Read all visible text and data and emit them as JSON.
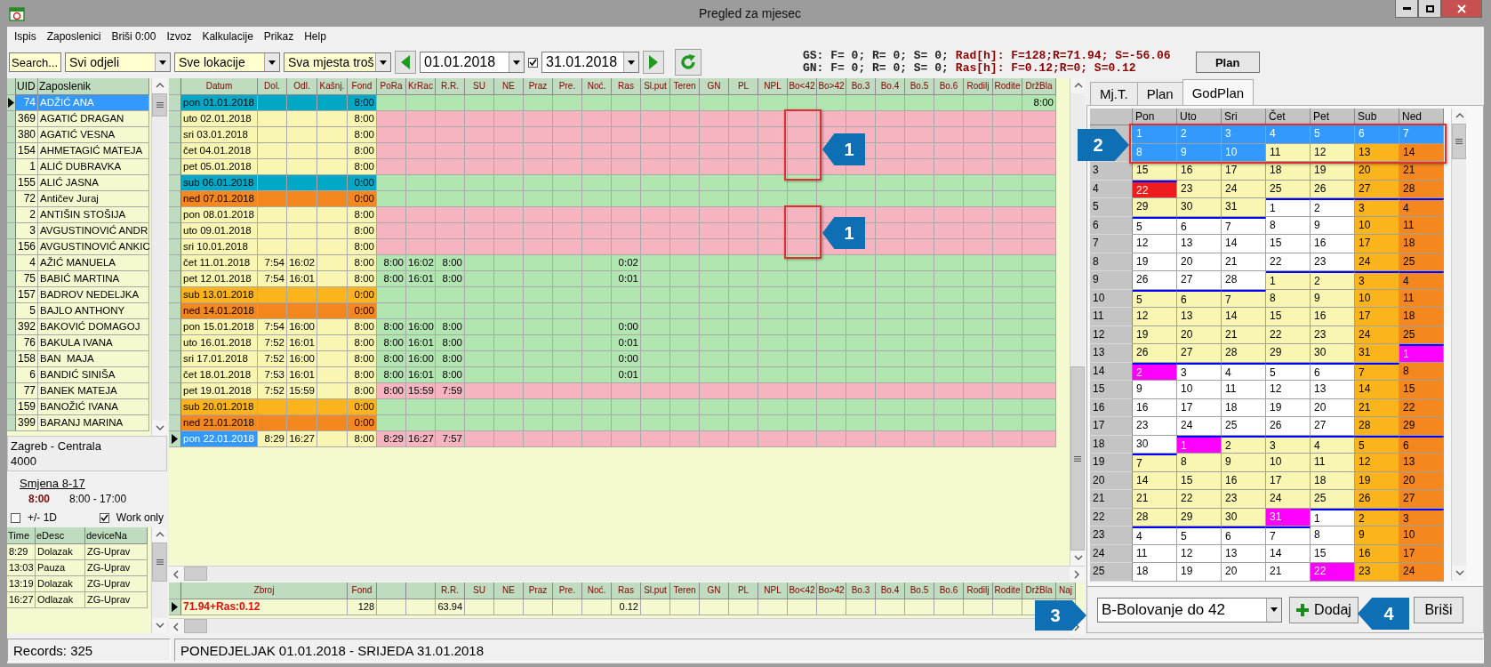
{
  "window": {
    "title": "Pregled za mjesec"
  },
  "menu": [
    "Ispis",
    "Zaposlenici",
    "Briši 0:00",
    "Izvoz",
    "Kalkulacije",
    "Prikaz",
    "Help"
  ],
  "toolbar": {
    "search": "Search...",
    "filters": [
      "Svi odjeli",
      "Sve lokacije",
      "Sva mjesta troš"
    ],
    "date_from": "01.01.2018",
    "date_to_enabled": true,
    "date_to": "31.01.2018"
  },
  "summary": [
    {
      "label": "GS: F= 0; R= 0; S= 0;",
      "value": "Rad[h]: F=128;R=71.94; S=-56.06"
    },
    {
      "label": "GN: F= 0; R= 0; S= 0;",
      "value": "Ras[h]: F=0.12;R=0; S=0.12"
    }
  ],
  "plan_button": "Plan",
  "employees": {
    "columns": [
      "UID",
      "Zaposlenik"
    ],
    "rows": [
      {
        "uid": "74",
        "name": "ADŽIĆ ANA",
        "selected": true
      },
      {
        "uid": "369",
        "name": "AGATIĆ DRAGAN",
        "selected": false
      },
      {
        "uid": "380",
        "name": "AGATIĆ VESNA",
        "selected": false
      },
      {
        "uid": "154",
        "name": "AHMETAGIĆ MATEJA",
        "selected": false
      },
      {
        "uid": "1",
        "name": "ALIĆ DUBRAVKA",
        "selected": false
      },
      {
        "uid": "155",
        "name": "ALIĆ JASNA",
        "selected": false
      },
      {
        "uid": "72",
        "name": "Antičev Juraj",
        "selected": false
      },
      {
        "uid": "2",
        "name": "ANTIŠIN STOŠIJA",
        "selected": false
      },
      {
        "uid": "3",
        "name": "AVGUSTINOVIĆ ANDR",
        "selected": false
      },
      {
        "uid": "156",
        "name": "AVGUSTINOVIĆ ANKIC",
        "selected": false
      },
      {
        "uid": "4",
        "name": "AŽIĆ MANUELA",
        "selected": false
      },
      {
        "uid": "75",
        "name": "BABIĆ MARTINA",
        "selected": false
      },
      {
        "uid": "157",
        "name": "BADROV NEDELJKA",
        "selected": false
      },
      {
        "uid": "5",
        "name": "BAJLO ANTHONY",
        "selected": false
      },
      {
        "uid": "392",
        "name": "BAKOVIĆ DOMAGOJ",
        "selected": false
      },
      {
        "uid": "76",
        "name": "BAKULA IVANA",
        "selected": false
      },
      {
        "uid": "158",
        "name": "BAN  MAJA",
        "selected": false
      },
      {
        "uid": "6",
        "name": "BANDIĆ SINIŠA",
        "selected": false
      },
      {
        "uid": "77",
        "name": "BANEK MATEJA",
        "selected": false
      },
      {
        "uid": "159",
        "name": "BANOŽIĆ IVANA",
        "selected": false
      },
      {
        "uid": "399",
        "name": "BARANJ MARINA",
        "selected": false
      }
    ]
  },
  "location": {
    "name": "Zagreb - Centrala",
    "code": "4000"
  },
  "shift": {
    "name": "Smjena 8-17",
    "hours": "8:00",
    "range": "8:00 - 17:00"
  },
  "options": [
    {
      "label": "+/- 1D",
      "checked": false
    },
    {
      "label": "Work only",
      "checked": true
    }
  ],
  "events": {
    "columns": [
      "Time",
      "eDesc",
      "deviceNa"
    ],
    "rows": [
      {
        "time": "8:29",
        "desc": "Dolazak",
        "device": "ZG-Uprav"
      },
      {
        "time": "13:03",
        "desc": "Pauza",
        "device": "ZG-Uprav"
      },
      {
        "time": "13:19",
        "desc": "Dolazak",
        "device": "ZG-Uprav"
      },
      {
        "time": "16:27",
        "desc": "Odlazak",
        "device": "ZG-Uprav"
      }
    ]
  },
  "days": {
    "columns": [
      "Datum",
      "Dol.",
      "Odl.",
      "Kašnj.",
      "Fond",
      "PoRa",
      "KrRac",
      "R.R.",
      "SU",
      "NE",
      "Praz",
      "Pre.",
      "Noć.",
      "Ras",
      "Sl.put",
      "Teren",
      "GN",
      "PL",
      "NPL",
      "Bo<42",
      "Bo>42",
      "Bo.3",
      "Bo.4",
      "Bo.5",
      "Bo.6",
      "Rodilj",
      "Rodite",
      "DržBla"
    ],
    "rows": [
      {
        "date": "pon 01.01.2018",
        "fond": "8:00",
        "extra": "8:00",
        "color": "#00a8c6",
        "complete": true,
        "selected": false
      },
      {
        "date": "uto 02.01.2018",
        "fond": "8:00",
        "color": "#f8f6b0",
        "complete": false,
        "selected": false
      },
      {
        "date": "sri 03.01.2018",
        "fond": "8:00",
        "color": "#f8f6b0",
        "complete": false,
        "selected": false
      },
      {
        "date": "čet 04.01.2018",
        "fond": "8:00",
        "color": "#f8f6b0",
        "complete": false,
        "selected": false
      },
      {
        "date": "pet 05.01.2018",
        "fond": "8:00",
        "color": "#f8f6b0",
        "complete": false,
        "selected": false
      },
      {
        "date": "sub 06.01.2018",
        "fond": "0:00",
        "color": "#00a8c6",
        "complete": true,
        "selected": false
      },
      {
        "date": "ned 07.01.2018",
        "fond": "0:00",
        "color": "#f4881f",
        "complete": true,
        "selected": false
      },
      {
        "date": "pon 08.01.2018",
        "fond": "8:00",
        "color": "#f8f6b0",
        "complete": false,
        "selected": false
      },
      {
        "date": "uto 09.01.2018",
        "fond": "8:00",
        "color": "#f8f6b0",
        "complete": false,
        "selected": false
      },
      {
        "date": "sri 10.01.2018",
        "fond": "8:00",
        "color": "#f8f6b0",
        "complete": false,
        "selected": false
      },
      {
        "date": "čet 11.01.2018",
        "in": "7:54",
        "out": "16:02",
        "fond": "8:00",
        "start": "8:00",
        "end": "16:02",
        "worked": "8:00",
        "ras": "0:02",
        "color": "#f8f6b0",
        "complete": true,
        "selected": false
      },
      {
        "date": "pet 12.01.2018",
        "in": "7:54",
        "out": "16:01",
        "fond": "8:00",
        "start": "8:00",
        "end": "16:01",
        "worked": "8:00",
        "ras": "0:01",
        "color": "#f8f6b0",
        "complete": true,
        "selected": false
      },
      {
        "date": "sub 13.01.2018",
        "fond": "0:00",
        "color": "#fbb41c",
        "complete": true,
        "selected": false
      },
      {
        "date": "ned 14.01.2018",
        "fond": "0:00",
        "color": "#f4881f",
        "complete": true,
        "selected": false
      },
      {
        "date": "pon 15.01.2018",
        "in": "7:54",
        "out": "16:00",
        "fond": "8:00",
        "start": "8:00",
        "end": "16:00",
        "worked": "8:00",
        "ras": "0:00",
        "color": "#f8f6b0",
        "complete": true,
        "selected": false
      },
      {
        "date": "uto 16.01.2018",
        "in": "7:52",
        "out": "16:01",
        "fond": "8:00",
        "start": "8:00",
        "end": "16:01",
        "worked": "8:00",
        "ras": "0:01",
        "color": "#f8f6b0",
        "complete": true,
        "selected": false
      },
      {
        "date": "sri 17.01.2018",
        "in": "7:52",
        "out": "16:00",
        "fond": "8:00",
        "start": "8:00",
        "end": "16:00",
        "worked": "8:00",
        "ras": "0:00",
        "color": "#f8f6b0",
        "complete": true,
        "selected": false
      },
      {
        "date": "čet 18.01.2018",
        "in": "7:53",
        "out": "16:01",
        "fond": "8:00",
        "start": "8:00",
        "end": "16:01",
        "worked": "8:00",
        "ras": "0:01",
        "color": "#f8f6b0",
        "complete": true,
        "selected": false
      },
      {
        "date": "pet 19.01.2018",
        "in": "7:52",
        "out": "15:59",
        "fond": "8:00",
        "start": "8:00",
        "end": "15:59",
        "worked": "7:59",
        "color": "#f8f6b0",
        "complete": false,
        "selected": false
      },
      {
        "date": "sub 20.01.2018",
        "fond": "0:00",
        "color": "#fbb41c",
        "complete": true,
        "selected": false
      },
      {
        "date": "ned 21.01.2018",
        "fond": "0:00",
        "color": "#f4881f",
        "complete": true,
        "selected": false
      },
      {
        "date": "pon 22.01.2018",
        "in": "8:29",
        "out": "16:27",
        "fond": "8:00",
        "start": "8:29",
        "end": "16:27",
        "worked": "7:57",
        "color": "#f8f6b0",
        "complete": false,
        "selected": true
      }
    ]
  },
  "totals": {
    "label": "Zbroj",
    "fond_label": "Fond",
    "columns": [
      "R.R.",
      "SU",
      "NE",
      "Praz",
      "Pre.",
      "Noć.",
      "Ras",
      "Sl.put",
      "Teren",
      "GN",
      "PL",
      "NPL",
      "Bo<42",
      "Bo>42",
      "Bo.3",
      "Bo.4",
      "Bo.5",
      "Bo.6",
      "Rodilj",
      "Rodite",
      "DržBla",
      "Naj"
    ],
    "row": {
      "total": "71.94+Ras:0.12",
      "fond": "128",
      "rr": "63.94",
      "ras": "0.12",
      "selected": true
    }
  },
  "tabs": [
    {
      "label": "Mj.T.",
      "selected": false
    },
    {
      "label": "Plan",
      "selected": false
    },
    {
      "label": "GodPlan",
      "selected": true
    }
  ],
  "calendar": {
    "columns": [
      "Pon",
      "Uto",
      "Sri",
      "Čet",
      "Pet",
      "Sub",
      "Ned"
    ],
    "weeks": [
      {
        "days": [
          {
            "day": "1",
            "color": "#3399ff",
            "month_edge": false
          },
          {
            "day": "2",
            "color": "#3399ff",
            "month_edge": false
          },
          {
            "day": "3",
            "color": "#3399ff",
            "month_edge": false
          },
          {
            "day": "4",
            "color": "#3399ff",
            "month_edge": false
          },
          {
            "day": "5",
            "color": "#3399ff",
            "month_edge": false
          },
          {
            "day": "6",
            "color": "#3399ff",
            "month_edge": false
          },
          {
            "day": "7",
            "color": "#3399ff",
            "month_edge": false
          }
        ]
      },
      {
        "days": [
          {
            "day": "8",
            "color": "#3399ff",
            "month_edge": false
          },
          {
            "day": "9",
            "color": "#3399ff",
            "month_edge": false
          },
          {
            "day": "10",
            "color": "#3399ff",
            "month_edge": false
          },
          {
            "day": "11",
            "color": "#f8f6b0",
            "month_edge": false
          },
          {
            "day": "12",
            "color": "#f8f6b0",
            "month_edge": false
          },
          {
            "day": "13",
            "color": "#fbb41c",
            "month_edge": false
          },
          {
            "day": "14",
            "color": "#f4881f",
            "month_edge": false
          }
        ]
      },
      {
        "week": "3",
        "days": [
          {
            "day": "15",
            "color": "#f8f6b0",
            "month_edge": false
          },
          {
            "day": "16",
            "color": "#f8f6b0",
            "month_edge": false
          },
          {
            "day": "17",
            "color": "#f8f6b0",
            "month_edge": false
          },
          {
            "day": "18",
            "color": "#f8f6b0",
            "month_edge": false
          },
          {
            "day": "19",
            "color": "#f8f6b0",
            "month_edge": false
          },
          {
            "day": "20",
            "color": "#fbb41c",
            "month_edge": false
          },
          {
            "day": "21",
            "color": "#f4881f",
            "month_edge": false
          }
        ]
      },
      {
        "week": "4",
        "days": [
          {
            "day": "22",
            "color": "#ee1c1c",
            "month_edge": true
          },
          {
            "day": "23",
            "color": "#f8f6b0",
            "month_edge": false
          },
          {
            "day": "24",
            "color": "#f8f6b0",
            "month_edge": false
          },
          {
            "day": "25",
            "color": "#f8f6b0",
            "month_edge": false
          },
          {
            "day": "26",
            "color": "#f8f6b0",
            "month_edge": false
          },
          {
            "day": "27",
            "color": "#fbb41c",
            "month_edge": false
          },
          {
            "day": "28",
            "color": "#f4881f",
            "month_edge": false
          }
        ]
      },
      {
        "week": "5",
        "days": [
          {
            "day": "29",
            "color": "#f8f6b0",
            "month_edge": false
          },
          {
            "day": "30",
            "color": "#f8f6b0",
            "month_edge": false
          },
          {
            "day": "31",
            "color": "#f8f6b0",
            "month_edge": false
          },
          {
            "day": "1",
            "color": "#ffffff",
            "month_edge": true
          },
          {
            "day": "2",
            "color": "#ffffff",
            "month_edge": true
          },
          {
            "day": "3",
            "color": "#fbb41c",
            "month_edge": true
          },
          {
            "day": "4",
            "color": "#f4881f",
            "month_edge": true
          }
        ]
      },
      {
        "week": "6",
        "days": [
          {
            "day": "5",
            "color": "#ffffff",
            "month_edge": true
          },
          {
            "day": "6",
            "color": "#ffffff",
            "month_edge": true
          },
          {
            "day": "7",
            "color": "#ffffff",
            "month_edge": true
          },
          {
            "day": "8",
            "color": "#ffffff",
            "month_edge": false
          },
          {
            "day": "9",
            "color": "#ffffff",
            "month_edge": false
          },
          {
            "day": "10",
            "color": "#fbb41c",
            "month_edge": false
          },
          {
            "day": "11",
            "color": "#f4881f",
            "month_edge": false
          }
        ]
      },
      {
        "week": "7",
        "days": [
          {
            "day": "12",
            "color": "#ffffff",
            "month_edge": false
          },
          {
            "day": "13",
            "color": "#ffffff",
            "month_edge": false
          },
          {
            "day": "14",
            "color": "#ffffff",
            "month_edge": false
          },
          {
            "day": "15",
            "color": "#ffffff",
            "month_edge": false
          },
          {
            "day": "16",
            "color": "#ffffff",
            "month_edge": false
          },
          {
            "day": "17",
            "color": "#fbb41c",
            "month_edge": false
          },
          {
            "day": "18",
            "color": "#f4881f",
            "month_edge": false
          }
        ]
      },
      {
        "week": "8",
        "days": [
          {
            "day": "19",
            "color": "#ffffff",
            "month_edge": false
          },
          {
            "day": "20",
            "color": "#ffffff",
            "month_edge": false
          },
          {
            "day": "21",
            "color": "#ffffff",
            "month_edge": false
          },
          {
            "day": "22",
            "color": "#ffffff",
            "month_edge": false
          },
          {
            "day": "23",
            "color": "#ffffff",
            "month_edge": false
          },
          {
            "day": "24",
            "color": "#fbb41c",
            "month_edge": false
          },
          {
            "day": "25",
            "color": "#f4881f",
            "month_edge": false
          }
        ]
      },
      {
        "week": "9",
        "days": [
          {
            "day": "26",
            "color": "#ffffff",
            "month_edge": false
          },
          {
            "day": "27",
            "color": "#ffffff",
            "month_edge": false
          },
          {
            "day": "28",
            "color": "#ffffff",
            "month_edge": false
          },
          {
            "day": "1",
            "color": "#f8f6b0",
            "month_edge": true
          },
          {
            "day": "2",
            "color": "#f8f6b0",
            "month_edge": true
          },
          {
            "day": "3",
            "color": "#fbb41c",
            "month_edge": true
          },
          {
            "day": "4",
            "color": "#f4881f",
            "month_edge": true
          }
        ]
      },
      {
        "week": "10",
        "days": [
          {
            "day": "5",
            "color": "#f8f6b0",
            "month_edge": true
          },
          {
            "day": "6",
            "color": "#f8f6b0",
            "month_edge": true
          },
          {
            "day": "7",
            "color": "#f8f6b0",
            "month_edge": true
          },
          {
            "day": "8",
            "color": "#f8f6b0",
            "month_edge": false
          },
          {
            "day": "9",
            "color": "#f8f6b0",
            "month_edge": false
          },
          {
            "day": "10",
            "color": "#fbb41c",
            "month_edge": false
          },
          {
            "day": "11",
            "color": "#f4881f",
            "month_edge": false
          }
        ]
      },
      {
        "week": "11",
        "days": [
          {
            "day": "12",
            "color": "#f8f6b0",
            "month_edge": false
          },
          {
            "day": "13",
            "color": "#f8f6b0",
            "month_edge": false
          },
          {
            "day": "14",
            "color": "#f8f6b0",
            "month_edge": false
          },
          {
            "day": "15",
            "color": "#f8f6b0",
            "month_edge": false
          },
          {
            "day": "16",
            "color": "#f8f6b0",
            "month_edge": false
          },
          {
            "day": "17",
            "color": "#fbb41c",
            "month_edge": false
          },
          {
            "day": "18",
            "color": "#f4881f",
            "month_edge": false
          }
        ]
      },
      {
        "week": "12",
        "days": [
          {
            "day": "19",
            "color": "#f8f6b0",
            "month_edge": false
          },
          {
            "day": "20",
            "color": "#f8f6b0",
            "month_edge": false
          },
          {
            "day": "21",
            "color": "#f8f6b0",
            "month_edge": false
          },
          {
            "day": "22",
            "color": "#f8f6b0",
            "month_edge": false
          },
          {
            "day": "23",
            "color": "#f8f6b0",
            "month_edge": false
          },
          {
            "day": "24",
            "color": "#fbb41c",
            "month_edge": false
          },
          {
            "day": "25",
            "color": "#f4881f",
            "month_edge": false
          }
        ]
      },
      {
        "week": "13",
        "days": [
          {
            "day": "26",
            "color": "#f8f6b0",
            "month_edge": false
          },
          {
            "day": "27",
            "color": "#f8f6b0",
            "month_edge": false
          },
          {
            "day": "28",
            "color": "#f8f6b0",
            "month_edge": false
          },
          {
            "day": "29",
            "color": "#f8f6b0",
            "month_edge": false
          },
          {
            "day": "30",
            "color": "#f8f6b0",
            "month_edge": false
          },
          {
            "day": "31",
            "color": "#fbb41c",
            "month_edge": false
          },
          {
            "day": "1",
            "color": "#ff00ff",
            "month_edge": true
          }
        ]
      },
      {
        "week": "14",
        "days": [
          {
            "day": "2",
            "color": "#ff00ff",
            "month_edge": true
          },
          {
            "day": "3",
            "color": "#ffffff",
            "month_edge": true
          },
          {
            "day": "4",
            "color": "#ffffff",
            "month_edge": true
          },
          {
            "day": "5",
            "color": "#ffffff",
            "month_edge": true
          },
          {
            "day": "6",
            "color": "#ffffff",
            "month_edge": true
          },
          {
            "day": "7",
            "color": "#fbb41c",
            "month_edge": true
          },
          {
            "day": "8",
            "color": "#f4881f",
            "month_edge": false
          }
        ]
      },
      {
        "week": "15",
        "days": [
          {
            "day": "9",
            "color": "#ffffff",
            "month_edge": false
          },
          {
            "day": "10",
            "color": "#ffffff",
            "month_edge": false
          },
          {
            "day": "11",
            "color": "#ffffff",
            "month_edge": false
          },
          {
            "day": "12",
            "color": "#ffffff",
            "month_edge": false
          },
          {
            "day": "13",
            "color": "#ffffff",
            "month_edge": false
          },
          {
            "day": "14",
            "color": "#fbb41c",
            "month_edge": false
          },
          {
            "day": "15",
            "color": "#f4881f",
            "month_edge": false
          }
        ]
      },
      {
        "week": "16",
        "days": [
          {
            "day": "16",
            "color": "#ffffff",
            "month_edge": false
          },
          {
            "day": "17",
            "color": "#ffffff",
            "month_edge": false
          },
          {
            "day": "18",
            "color": "#ffffff",
            "month_edge": false
          },
          {
            "day": "19",
            "color": "#ffffff",
            "month_edge": false
          },
          {
            "day": "20",
            "color": "#ffffff",
            "month_edge": false
          },
          {
            "day": "21",
            "color": "#fbb41c",
            "month_edge": false
          },
          {
            "day": "22",
            "color": "#f4881f",
            "month_edge": false
          }
        ]
      },
      {
        "week": "17",
        "days": [
          {
            "day": "23",
            "color": "#ffffff",
            "month_edge": false
          },
          {
            "day": "24",
            "color": "#ffffff",
            "month_edge": false
          },
          {
            "day": "25",
            "color": "#ffffff",
            "month_edge": false
          },
          {
            "day": "26",
            "color": "#ffffff",
            "month_edge": false
          },
          {
            "day": "27",
            "color": "#ffffff",
            "month_edge": false
          },
          {
            "day": "28",
            "color": "#fbb41c",
            "month_edge": false
          },
          {
            "day": "29",
            "color": "#f4881f",
            "month_edge": false
          }
        ]
      },
      {
        "week": "18",
        "days": [
          {
            "day": "30",
            "color": "#ffffff",
            "month_edge": false
          },
          {
            "day": "1",
            "color": "#ff00ff",
            "month_edge": true
          },
          {
            "day": "2",
            "color": "#f8f6b0",
            "month_edge": true
          },
          {
            "day": "3",
            "color": "#f8f6b0",
            "month_edge": true
          },
          {
            "day": "4",
            "color": "#f8f6b0",
            "month_edge": true
          },
          {
            "day": "5",
            "color": "#fbb41c",
            "month_edge": true
          },
          {
            "day": "6",
            "color": "#f4881f",
            "month_edge": true
          }
        ]
      },
      {
        "week": "19",
        "days": [
          {
            "day": "7",
            "color": "#f8f6b0",
            "month_edge": true
          },
          {
            "day": "8",
            "color": "#f8f6b0",
            "month_edge": false
          },
          {
            "day": "9",
            "color": "#f8f6b0",
            "month_edge": false
          },
          {
            "day": "10",
            "color": "#f8f6b0",
            "month_edge": false
          },
          {
            "day": "11",
            "color": "#f8f6b0",
            "month_edge": false
          },
          {
            "day": "12",
            "color": "#fbb41c",
            "month_edge": false
          },
          {
            "day": "13",
            "color": "#f4881f",
            "month_edge": false
          }
        ]
      },
      {
        "week": "20",
        "days": [
          {
            "day": "14",
            "color": "#f8f6b0",
            "month_edge": false
          },
          {
            "day": "15",
            "color": "#f8f6b0",
            "month_edge": false
          },
          {
            "day": "16",
            "color": "#f8f6b0",
            "month_edge": false
          },
          {
            "day": "17",
            "color": "#f8f6b0",
            "month_edge": false
          },
          {
            "day": "18",
            "color": "#f8f6b0",
            "month_edge": false
          },
          {
            "day": "19",
            "color": "#fbb41c",
            "month_edge": false
          },
          {
            "day": "20",
            "color": "#f4881f",
            "month_edge": false
          }
        ]
      },
      {
        "week": "21",
        "days": [
          {
            "day": "21",
            "color": "#f8f6b0",
            "month_edge": false
          },
          {
            "day": "22",
            "color": "#f8f6b0",
            "month_edge": false
          },
          {
            "day": "23",
            "color": "#f8f6b0",
            "month_edge": false
          },
          {
            "day": "24",
            "color": "#f8f6b0",
            "month_edge": false
          },
          {
            "day": "25",
            "color": "#f8f6b0",
            "month_edge": false
          },
          {
            "day": "26",
            "color": "#fbb41c",
            "month_edge": false
          },
          {
            "day": "27",
            "color": "#f4881f",
            "month_edge": false
          }
        ]
      },
      {
        "week": "22",
        "days": [
          {
            "day": "28",
            "color": "#f8f6b0",
            "month_edge": false
          },
          {
            "day": "29",
            "color": "#f8f6b0",
            "month_edge": false
          },
          {
            "day": "30",
            "color": "#f8f6b0",
            "month_edge": false
          },
          {
            "day": "31",
            "color": "#ff00ff",
            "month_edge": false
          },
          {
            "day": "1",
            "color": "#ffffff",
            "month_edge": true
          },
          {
            "day": "2",
            "color": "#fbb41c",
            "month_edge": true
          },
          {
            "day": "3",
            "color": "#f4881f",
            "month_edge": true
          }
        ]
      },
      {
        "week": "23",
        "days": [
          {
            "day": "4",
            "color": "#ffffff",
            "month_edge": true
          },
          {
            "day": "5",
            "color": "#ffffff",
            "month_edge": true
          },
          {
            "day": "6",
            "color": "#ffffff",
            "month_edge": true
          },
          {
            "day": "7",
            "color": "#ffffff",
            "month_edge": true
          },
          {
            "day": "8",
            "color": "#ffffff",
            "month_edge": false
          },
          {
            "day": "9",
            "color": "#fbb41c",
            "month_edge": false
          },
          {
            "day": "10",
            "color": "#f4881f",
            "month_edge": false
          }
        ]
      },
      {
        "week": "24",
        "days": [
          {
            "day": "11",
            "color": "#ffffff",
            "month_edge": false
          },
          {
            "day": "12",
            "color": "#ffffff",
            "month_edge": false
          },
          {
            "day": "13",
            "color": "#ffffff",
            "month_edge": false
          },
          {
            "day": "14",
            "color": "#ffffff",
            "month_edge": false
          },
          {
            "day": "15",
            "color": "#ffffff",
            "month_edge": false
          },
          {
            "day": "16",
            "color": "#fbb41c",
            "month_edge": false
          },
          {
            "day": "17",
            "color": "#f4881f",
            "month_edge": false
          }
        ]
      },
      {
        "week": "25",
        "days": [
          {
            "day": "18",
            "color": "#ffffff",
            "month_edge": false
          },
          {
            "day": "19",
            "color": "#ffffff",
            "month_edge": false
          },
          {
            "day": "20",
            "color": "#ffffff",
            "month_edge": false
          },
          {
            "day": "21",
            "color": "#ffffff",
            "month_edge": false
          },
          {
            "day": "22",
            "color": "#ff00ff",
            "month_edge": false
          },
          {
            "day": "23",
            "color": "#fbb41c",
            "month_edge": false
          },
          {
            "day": "24",
            "color": "#f4881f",
            "month_edge": false
          }
        ]
      }
    ]
  },
  "absence_type": "B-Bolovanje do 42",
  "buttons": [
    "Dodaj",
    "Briši"
  ],
  "status_bar": {
    "records": "Records: 325",
    "period": "PONEDJELJAK 01.01.2018 - SRIJEDA 31.01.2018"
  },
  "callouts": [
    {
      "label": "1",
      "boxed": true
    },
    {
      "label": "1",
      "boxed": true
    },
    {
      "label": "2",
      "boxed": true
    },
    {
      "label": "3",
      "boxed": false
    },
    {
      "label": "4",
      "boxed": false
    }
  ]
}
